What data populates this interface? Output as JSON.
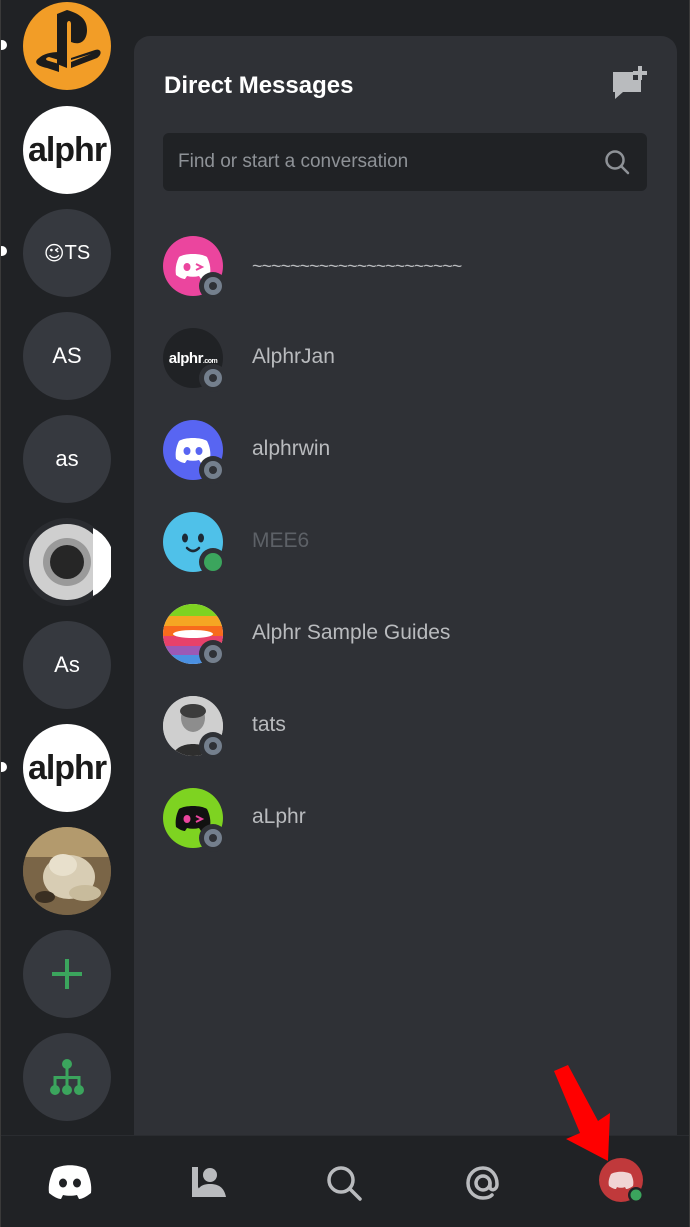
{
  "servers": [
    {
      "name": "playstation-server",
      "kind": "image",
      "bg": "#f29d27"
    },
    {
      "name": "alphr-server",
      "kind": "text-logo",
      "label": "alphr",
      "bg": "#ffffff",
      "fg": "#1b1b1b"
    },
    {
      "name": "ts-server",
      "kind": "initials",
      "emoji": "😉",
      "label": "TS"
    },
    {
      "name": "as-server",
      "kind": "initials",
      "label": "AS"
    },
    {
      "name": "as-lower-server",
      "kind": "initials",
      "label": "as"
    },
    {
      "name": "ring-server",
      "kind": "image"
    },
    {
      "name": "as-mixed-server",
      "kind": "initials",
      "label": "As"
    },
    {
      "name": "alphr-server-2",
      "kind": "text-logo",
      "label": "alphr",
      "bg": "#ffffff",
      "fg": "#1b1b1b"
    },
    {
      "name": "photo-server",
      "kind": "image"
    }
  ],
  "rail_actions": {
    "add_server": "add-server-button",
    "explore": "explore-servers-button",
    "accent": "#3ba55d"
  },
  "dm_panel": {
    "title": "Direct Messages",
    "search_placeholder": "Find or start a conversation",
    "conversations": [
      {
        "name": "~~~~~~~~~~~~~~~~~~~~~~",
        "avatar": "discord-logo",
        "avatar_bg": "#eb459e",
        "status": "offline"
      },
      {
        "name": "AlphrJan",
        "avatar": "alphr-com-logo",
        "avatar_bg": "#202225",
        "status": "offline"
      },
      {
        "name": "alphrwin",
        "avatar": "discord-logo",
        "avatar_bg": "#5865f2",
        "status": "offline"
      },
      {
        "name": "MEE6",
        "avatar": "mee6-face",
        "avatar_bg": "#4fc1e9",
        "status": "online",
        "dim": true
      },
      {
        "name": "Alphr Sample Guides",
        "avatar": "rainbow-stripes",
        "avatar_bg": "#ffffff",
        "status": "offline"
      },
      {
        "name": "tats",
        "avatar": "person-photo",
        "avatar_bg": "#bdbdbd",
        "status": "offline"
      },
      {
        "name": "aLphr",
        "avatar": "discord-logo",
        "avatar_bg": "#7ed321",
        "status": "offline"
      }
    ]
  },
  "bottom_nav": [
    {
      "name": "home-tab",
      "icon": "discord-logo-icon"
    },
    {
      "name": "friends-tab",
      "icon": "friends-icon"
    },
    {
      "name": "search-tab",
      "icon": "search-icon"
    },
    {
      "name": "mentions-tab",
      "icon": "at-mention-icon"
    },
    {
      "name": "profile-tab",
      "icon": "user-avatar-icon",
      "avatar_bg": "#c0393b",
      "status": "online"
    }
  ],
  "colors": {
    "rail_bg": "#202225",
    "panel_bg": "#2f3136",
    "text_muted": "#b9bbbe",
    "online": "#3ba55d",
    "offline": "#747f8d",
    "annotation_arrow": "#ff0000"
  }
}
